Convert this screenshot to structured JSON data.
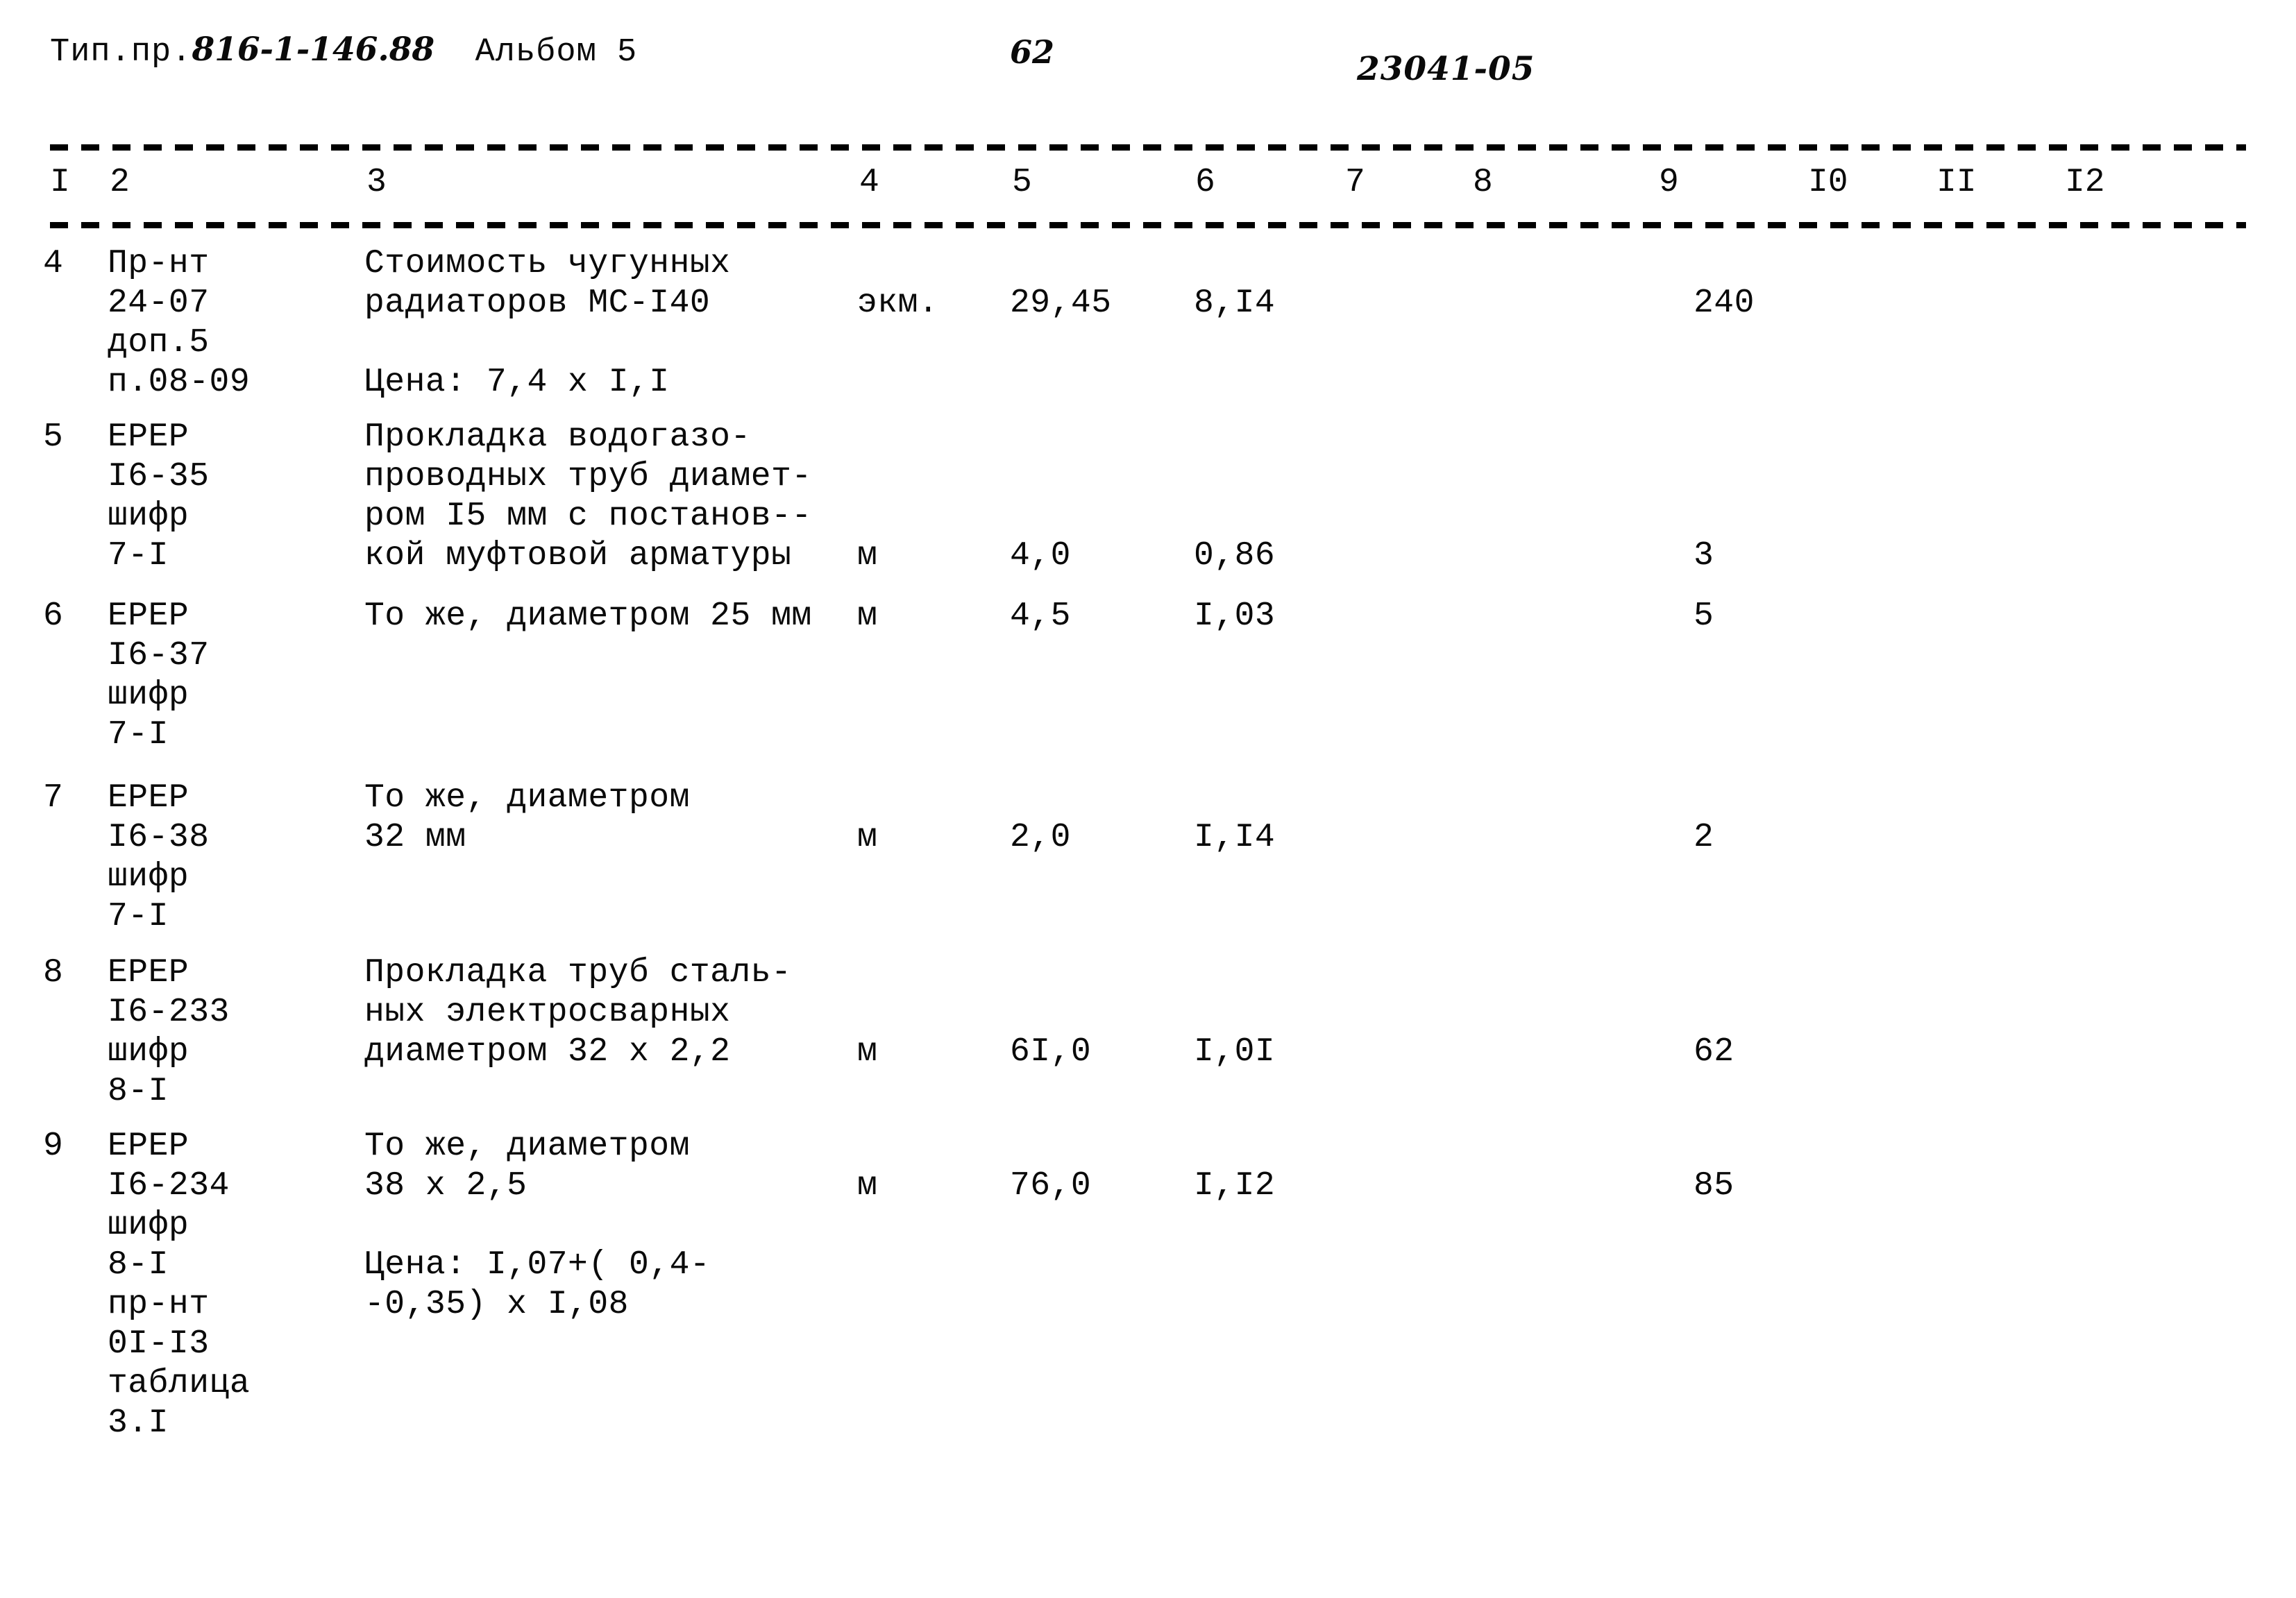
{
  "header": {
    "doc_label": "Тип.пр.",
    "doc_number": "816-1-146.88",
    "album_label": "Альбом 5",
    "page_number": "62",
    "doc_code": "23041-05"
  },
  "table": {
    "column_numbers": [
      "I",
      "2",
      "3",
      "4",
      "5",
      "6",
      "7",
      "8",
      "9",
      "I0",
      "II",
      "I2"
    ],
    "rows": [
      {
        "num": "4",
        "code_lines": [
          "Пр-нт",
          "24-07",
          "доп.5",
          "п.08-09"
        ],
        "desc_lines": [
          "Стоимость чугунных",
          "радиаторов МС-I40",
          "",
          "Цена: 7,4 х I,I"
        ],
        "unit": "экм.",
        "qty": "29,45",
        "price": "8,I4",
        "c7": "",
        "c8": "",
        "c9": "240",
        "c10": "",
        "c11": "",
        "c12": ""
      },
      {
        "num": "5",
        "code_lines": [
          "ЕРЕР",
          "I6-35",
          "шифр",
          "7-I"
        ],
        "desc_lines": [
          "Прокладка водогазо-",
          "проводных труб диамет-",
          "ром I5 мм с постанов--",
          "кой муфтовой арматуры"
        ],
        "unit": "м",
        "qty": "4,0",
        "price": "0,86",
        "c7": "",
        "c8": "",
        "c9": "3",
        "c10": "",
        "c11": "",
        "c12": ""
      },
      {
        "num": "6",
        "code_lines": [
          "ЕРЕР",
          "I6-37",
          "шифр",
          "7-I"
        ],
        "desc_lines": [
          "То же, диаметром 25 мм"
        ],
        "unit": "м",
        "qty": "4,5",
        "price": "I,03",
        "c7": "",
        "c8": "",
        "c9": "5",
        "c10": "",
        "c11": "",
        "c12": ""
      },
      {
        "num": "7",
        "code_lines": [
          "ЕРЕР",
          "I6-38",
          "шифр",
          "7-I"
        ],
        "desc_lines": [
          "То же, диаметром",
          "32 мм"
        ],
        "unit": "м",
        "qty": "2,0",
        "price": "I,I4",
        "c7": "",
        "c8": "",
        "c9": "2",
        "c10": "",
        "c11": "",
        "c12": ""
      },
      {
        "num": "8",
        "code_lines": [
          "ЕРЕР",
          "I6-233",
          "шифр",
          "8-I"
        ],
        "desc_lines": [
          "Прокладка труб сталь-",
          "ных электросварных",
          "диаметром 32 х 2,2"
        ],
        "unit": "м",
        "qty": "6I,0",
        "price": "I,0I",
        "c7": "",
        "c8": "",
        "c9": "62",
        "c10": "",
        "c11": "",
        "c12": ""
      },
      {
        "num": "9",
        "code_lines": [
          "ЕРЕР",
          "I6-234",
          "шифр",
          "8-I",
          "пр-нт",
          "0I-I3",
          "таблица",
          "3.I"
        ],
        "desc_lines": [
          "То же, диаметром",
          "38 х 2,5",
          "",
          "Цена: I,07+( 0,4-",
          "-0,35) х I,08"
        ],
        "unit": "м",
        "qty": "76,0",
        "price": "I,I2",
        "c7": "",
        "c8": "",
        "c9": "85",
        "c10": "",
        "c11": "",
        "c12": ""
      }
    ]
  }
}
